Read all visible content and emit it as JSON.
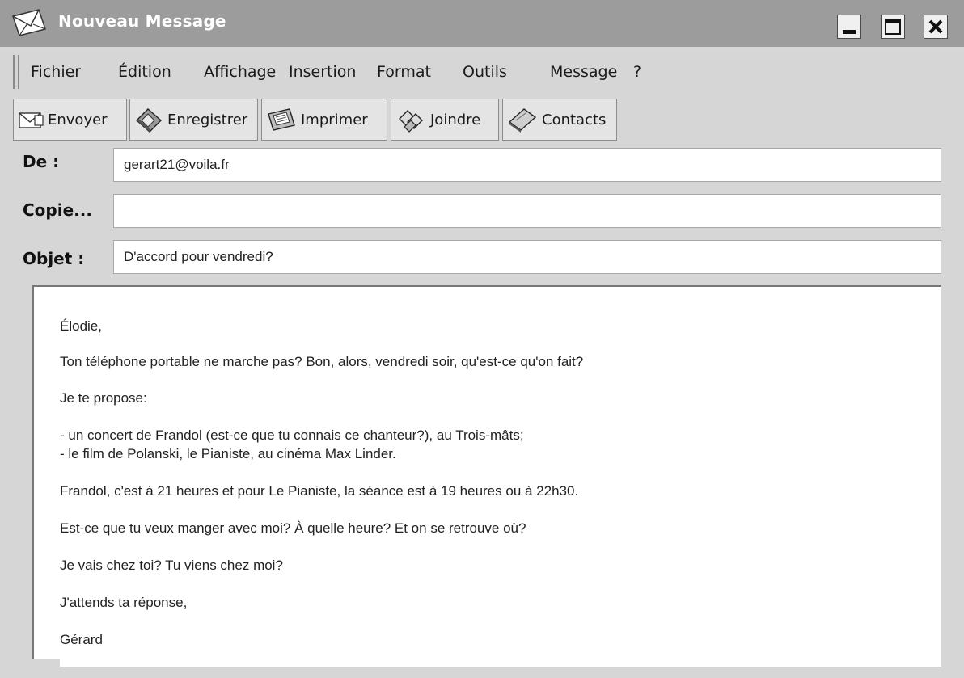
{
  "window": {
    "title": "Nouveau Message",
    "icon": "envelope-icon",
    "controls": [
      "minimize-icon",
      "maximize-icon",
      "close-icon"
    ]
  },
  "menu": {
    "items": [
      "Fichier",
      "Édition",
      "Affichage",
      "Insertion",
      "Format",
      "Outils",
      "Message",
      "?"
    ]
  },
  "toolbar": {
    "send_label": "Envoyer",
    "save_label": "Enregistrer",
    "print_label": "Imprimer",
    "attach_label": "Joindre",
    "contacts_label": "Contacts"
  },
  "header": {
    "from_label": "De :",
    "from_value": "gerart21@voila.fr",
    "cc_label": "Copie...",
    "cc_value": "",
    "subject_label": "Objet :",
    "subject_value": "D'accord pour vendredi?"
  },
  "body": {
    "lines": [
      "Élodie,",
      "Ton téléphone portable ne marche pas?  Bon, alors, vendredi soir, qu'est-ce qu'on fait?",
      "Je te propose:",
      "- un concert de Frandol (est-ce que tu connais ce chanteur?), au Trois-mâts;",
      "- le film de Polanski, le Pianiste, au cinéma Max Linder.",
      "Frandol, c'est à 21 heures et pour Le Pianiste, la séance est à 19 heures ou à 22h30.",
      "Est-ce que tu veux manger avec moi? À quelle heure? Et on se retrouve où?",
      "Je vais chez toi? Tu viens chez moi?",
      "J'attends ta réponse,",
      "Gérard"
    ]
  }
}
